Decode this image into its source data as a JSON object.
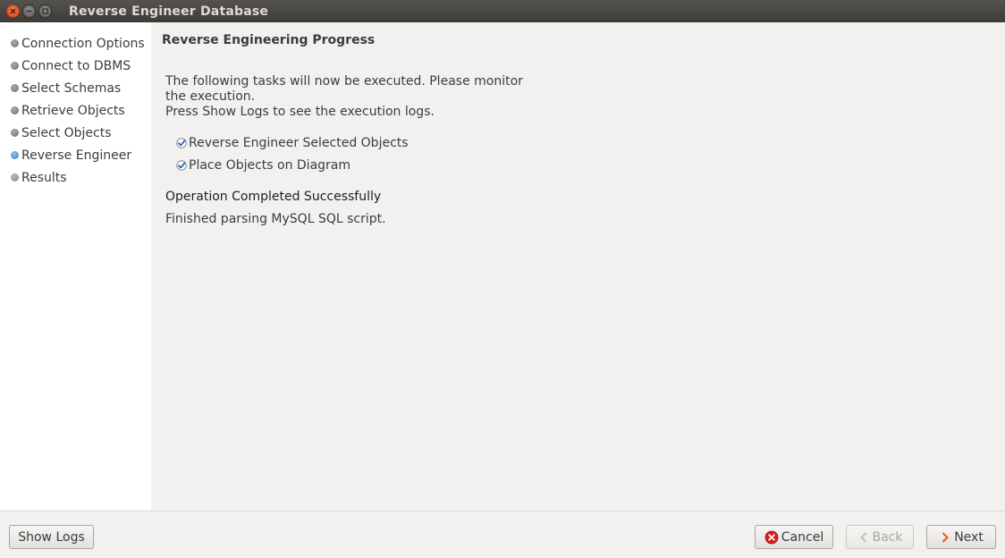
{
  "window": {
    "title": "Reverse Engineer Database"
  },
  "sidebar": {
    "steps": [
      {
        "label": "Connection Options",
        "state": "done"
      },
      {
        "label": "Connect to DBMS",
        "state": "done"
      },
      {
        "label": "Select Schemas",
        "state": "done"
      },
      {
        "label": "Retrieve Objects",
        "state": "done"
      },
      {
        "label": "Select Objects",
        "state": "done"
      },
      {
        "label": "Reverse Engineer",
        "state": "active"
      },
      {
        "label": "Results",
        "state": "pending"
      }
    ]
  },
  "main": {
    "heading": "Reverse Engineering Progress",
    "description_line1": "The following tasks will now be executed. Please monitor",
    "description_line2": "the execution.",
    "description_line3": "Press Show Logs to see the execution logs.",
    "tasks": [
      {
        "label": "Reverse Engineer Selected Objects",
        "checked": true
      },
      {
        "label": "Place Objects on Diagram",
        "checked": true
      }
    ],
    "status": "Operation Completed Successfully",
    "message": "Finished parsing MySQL SQL script."
  },
  "footer": {
    "show_logs_label": "Show Logs",
    "cancel_label": "Cancel",
    "back_label": "Back",
    "next_label": "Next"
  },
  "colors": {
    "active_step": "#3b7fc4",
    "check_blue": "#2a5db0",
    "cancel_red": "#d42020",
    "next_orange": "#e8591c"
  }
}
